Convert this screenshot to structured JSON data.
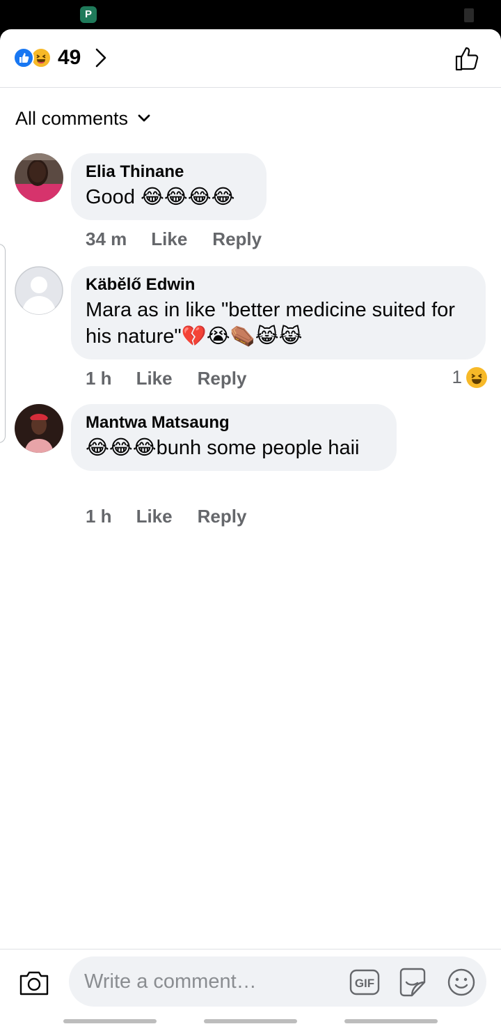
{
  "reactions": {
    "count": "49",
    "icons": [
      "like-icon",
      "haha-icon"
    ]
  },
  "filter": {
    "label": "All comments"
  },
  "comments": [
    {
      "author": "Elia Thinane",
      "text": "Good 😂😂😂😂",
      "time": "34 m",
      "like_label": "Like",
      "reply_label": "Reply",
      "avatar": "profile-photo"
    },
    {
      "author": "Käbĕlő Edwin",
      "text": "Mara as in like \"better medicine suited for his nature\"💔😭⚰️😹😹",
      "time": "1 h",
      "like_label": "Like",
      "reply_label": "Reply",
      "reaction_count": "1",
      "reaction_icon": "haha-icon",
      "avatar": "default-avatar"
    },
    {
      "author": "Mantwa Matsaung",
      "text": "😂😂😂bunh some people haii",
      "time": "1 h",
      "like_label": "Like",
      "reply_label": "Reply",
      "avatar": "profile-photo"
    }
  ],
  "composer": {
    "placeholder": "Write a comment…",
    "gif_label": "GIF",
    "icons": [
      "camera-icon",
      "gif-icon",
      "sticker-icon",
      "emoji-icon"
    ]
  },
  "colors": {
    "accent": "#1877f2",
    "haha": "#f7b928",
    "bubble": "#f0f2f5",
    "meta_text": "#65676b"
  }
}
